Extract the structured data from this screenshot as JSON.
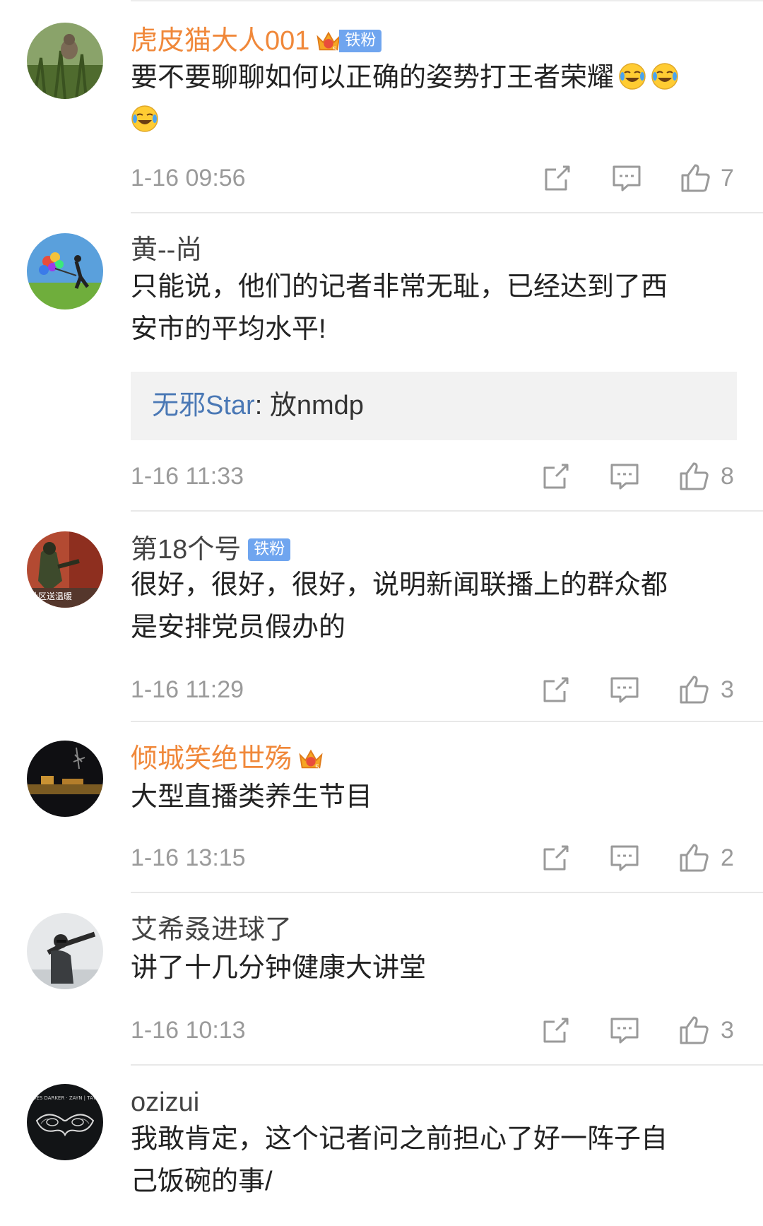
{
  "comments": [
    {
      "username": "虎皮猫大人001",
      "vip": true,
      "badge": "铁粉",
      "text": "要不要聊聊如何以正确的姿势打王者荣耀",
      "emojis": [
        "laugh-cry-emoji",
        "laugh-cry-emoji",
        "laugh-cry-emoji"
      ],
      "time": "1-16 09:56",
      "likes": "7"
    },
    {
      "username": "黄--尚",
      "vip": false,
      "text": "只能说，他们的记者非常无耻，已经达到了西安市的平均水平!",
      "reply": {
        "name": "无邪Star",
        "sep": ": ",
        "text": "放nmdp"
      },
      "time": "1-16 11:33",
      "likes": "8"
    },
    {
      "username": "第18个号",
      "vip": false,
      "badge": "铁粉",
      "avatar_text": "社区送温暖",
      "text": "很好，很好，很好，说明新闻联播上的群众都是安排党员假办的",
      "time": "1-16 11:29",
      "likes": "3"
    },
    {
      "username": "倾城笑绝世殇",
      "vip": true,
      "text": "大型直播类养生节目",
      "time": "1-16 13:15",
      "likes": "2"
    },
    {
      "username": "艾希叒进球了",
      "vip": false,
      "text": "讲了十几分钟健康大讲堂",
      "time": "1-16 10:13",
      "likes": "3"
    },
    {
      "username": "ozizui",
      "vip": false,
      "avatar_text": "FIFTY SHADES DARKER · ZAYN | TAYLOR SWIFT",
      "text": "我敢肯定，这个记者问之前担心了好一阵子自己饭碗的事/"
    }
  ],
  "icons": {
    "share": "share-icon",
    "comment": "comment-icon",
    "like": "thumbs-up-icon"
  },
  "colors": {
    "vip_name": "#f0883a",
    "normal_name": "#444444",
    "reply_name": "#4a78b5",
    "badge": "#6fa5ef",
    "meta": "#9a9a9a"
  }
}
